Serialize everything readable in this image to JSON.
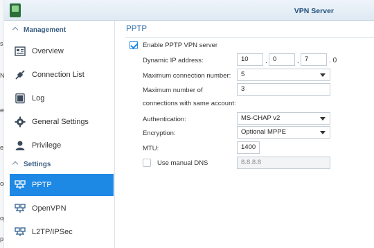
{
  "window": {
    "title": "VPN Server"
  },
  "background": {
    "fragments": [
      "s",
      "N",
      "ec",
      "e",
      "co",
      "op",
      "p"
    ]
  },
  "sidebar": {
    "sections": [
      {
        "label": "Management",
        "items": [
          {
            "label": "Overview",
            "icon": "overview-icon"
          },
          {
            "label": "Connection List",
            "icon": "plug-icon"
          },
          {
            "label": "Log",
            "icon": "log-icon"
          },
          {
            "label": "General Settings",
            "icon": "gear-icon"
          },
          {
            "label": "Privilege",
            "icon": "user-icon"
          }
        ]
      },
      {
        "label": "Settings",
        "items": [
          {
            "label": "PPTP",
            "icon": "network-icon",
            "active": true
          },
          {
            "label": "OpenVPN",
            "icon": "network-icon"
          },
          {
            "label": "L2TP/IPSec",
            "icon": "network-icon"
          }
        ]
      }
    ]
  },
  "panel": {
    "title": "PPTP",
    "enable_label": "Enable PPTP VPN server",
    "enable_checked": true,
    "dynamic_ip_label": "Dynamic IP address:",
    "dynamic_ip": {
      "o1": "10",
      "o2": "0",
      "o3": "7",
      "o4": "0"
    },
    "max_conn_label": "Maximum connection number:",
    "max_conn_value": "5",
    "max_same_label_1": "Maximum number of",
    "max_same_label_2": "connections with same account:",
    "max_same_value": "3",
    "auth_label": "Authentication:",
    "auth_value": "MS-CHAP v2",
    "enc_label": "Encryption:",
    "enc_value": "Optional MPPE",
    "mtu_label": "MTU:",
    "mtu_value": "1400",
    "dns_label": "Use manual DNS",
    "dns_checked": false,
    "dns_value": "8.8.8.8"
  }
}
